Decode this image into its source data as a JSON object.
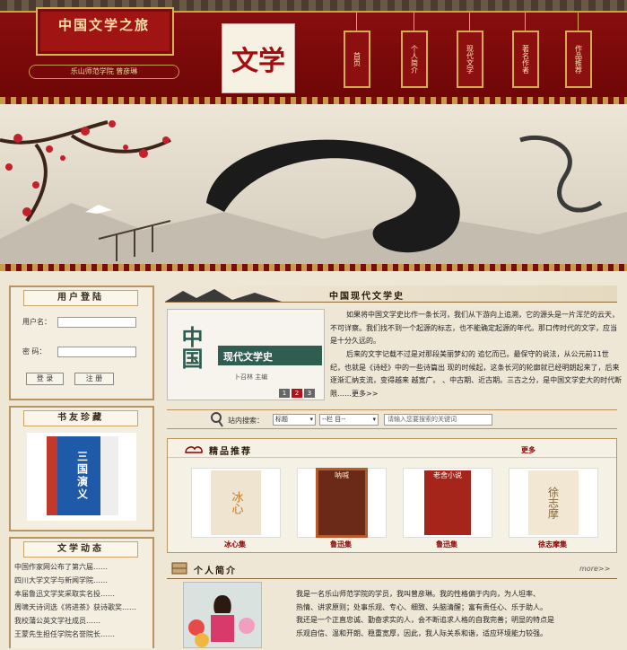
{
  "header": {
    "site_title": "中国文学之旅",
    "subtitle": "乐山师范学院 曾彦琳",
    "emblem_text": "文学",
    "nav": [
      "首页",
      "个人简介",
      "现代文学",
      "著名作者",
      "作品推荐"
    ]
  },
  "login": {
    "title": "用户登陆",
    "username_label": "用户名：",
    "password_label": "密  码：",
    "login_button": "登 录",
    "register_button": "注 册"
  },
  "friends": {
    "title": "书友珍藏",
    "book_title": "三国演义"
  },
  "news": {
    "title": "文学动态",
    "items": [
      "中国作家网公布了第六届……",
      "四川大学文学与新闻学院……",
      "本届鲁迅文学奖采取实名投……",
      "周啸天诗词选《将进茶》获诗歌奖……",
      "我校蒲公英文学社成员……",
      "王蒙先生担任学院名誉院长……"
    ]
  },
  "modern": {
    "section_title": "中国现代文学史",
    "book_cover_title": "现代文学史",
    "book_cover_author": "卜召林  主编",
    "book_cover_big": "中国",
    "pager": [
      "1",
      "2",
      "3"
    ],
    "paragraph1": "如果将中国文学史比作一条长河，我们从下游向上追溯，它的源头是一片浑茫的云天，不可详察。我们找不到一个起源的标志，也不能确定起源的年代。那口传时代的文学，应当是十分久远的。",
    "paragraph2": "后来的文字记载不过是对那段美丽梦幻的 追忆而已。最保守的说法，从公元前11世纪，也就是《诗经》中的一些诗篇出 现的时候起，这条长河的轮廓就已经明朗起来了，后来逐渐汇纳支流，变得越来 越宽广。 、中古期、近古期。三古之分，是中国文学史大的时代断限",
    "more": "……更多>>"
  },
  "search": {
    "label": "站内搜索：",
    "select1": "标题",
    "select2": "--栏 目--",
    "placeholder": "请输入您要搜索的关键词"
  },
  "recommend": {
    "title": "精品推荐",
    "more": "更多",
    "items": [
      {
        "caption": "冰心集",
        "cover": "冰心"
      },
      {
        "caption": "鲁迅集",
        "cover": "呐喊"
      },
      {
        "caption": "鲁迅集",
        "cover": "老舍小说"
      },
      {
        "caption": "徐志摩集",
        "cover": "徐志摩"
      }
    ]
  },
  "profile": {
    "title": "个人简介",
    "more": "more>>",
    "line1": "我是一名乐山师范学院的学员，我叫曾彦琳。我的性格偏于内向，为人坦率、",
    "line2": "热情、讲求原则；处事乐观、专心、细致、头脑清醒；富有责任心、乐于助人。",
    "line3": "我还是一个正直忠诚、勤奋求实的人，会不断追求人格的自我完善；明显的特点是",
    "line4": "乐观自信、温和开朗、稳重宽厚，因此，我人际关系和谐，适应环境能力较强。"
  },
  "colors": {
    "header_red": "#8c0f0f",
    "gold": "#d7ab52",
    "dark_red_text": "#8b0000"
  }
}
